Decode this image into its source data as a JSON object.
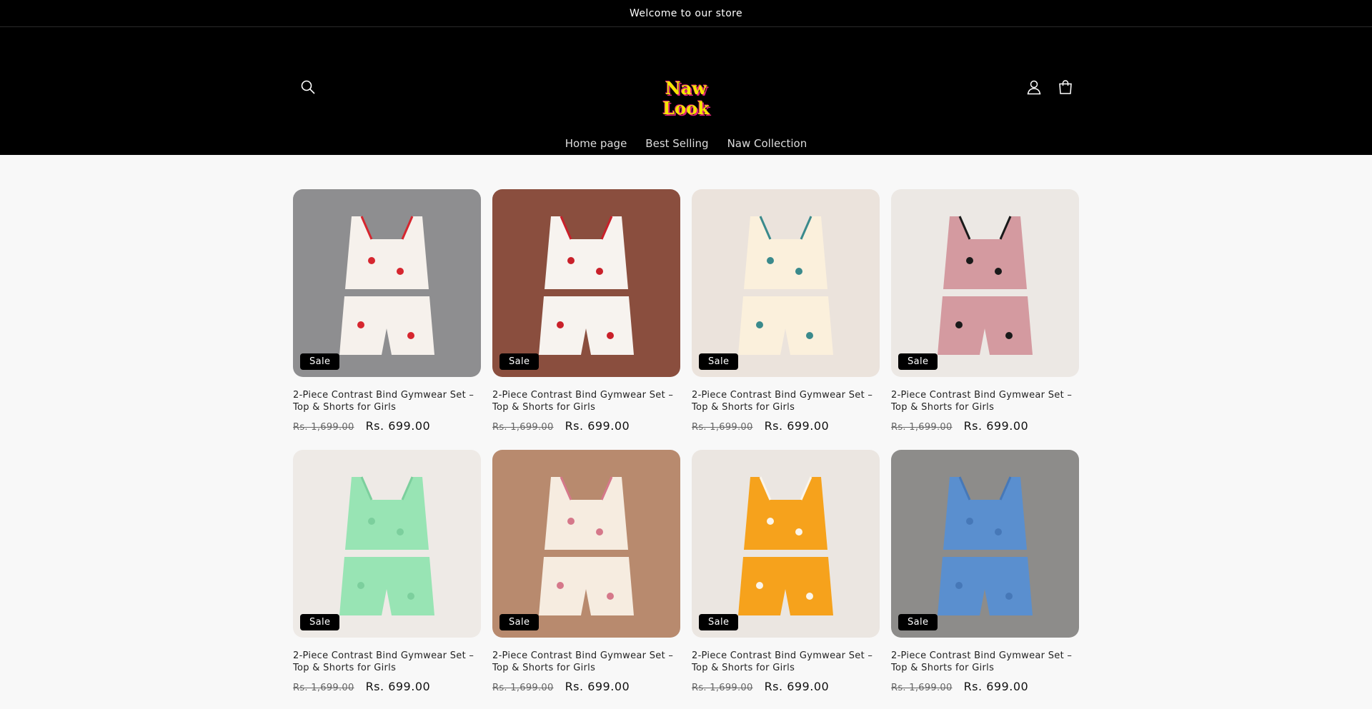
{
  "announcement": "Welcome to our store",
  "logo": {
    "line1": "Naw",
    "line2": "Look"
  },
  "nav": [
    {
      "label": "Home page"
    },
    {
      "label": "Best Selling"
    },
    {
      "label": "Naw Collection"
    }
  ],
  "icons": {
    "search": "search-icon",
    "account": "account-icon",
    "cart": "cart-icon"
  },
  "colors": {
    "header_bg": "#000000",
    "page_bg": "#f8f8f8",
    "logo_yellow": "#f3e600",
    "logo_pink": "#e0247a"
  },
  "products": [
    {
      "title": "2-Piece Contrast Bind Gymwear Set – Top & Shorts for Girls",
      "badge": "Sale",
      "compare_price": "Rs. 1,699.00",
      "price": "Rs. 699.00",
      "bg": "#8e8e90",
      "garment": "#f6f1ec",
      "accent": "#d6262f"
    },
    {
      "title": "2-Piece Contrast Bind Gymwear Set – Top & Shorts for Girls",
      "badge": "Sale",
      "compare_price": "Rs. 1,699.00",
      "price": "Rs. 699.00",
      "bg": "#8a4e3e",
      "garment": "#f7f3ef",
      "accent": "#c9202a"
    },
    {
      "title": "2-Piece Contrast Bind Gymwear Set – Top & Shorts for Girls",
      "badge": "Sale",
      "compare_price": "Rs. 1,699.00",
      "price": "Rs. 699.00",
      "bg": "#ebe3dc",
      "garment": "#fbf0dc",
      "accent": "#3a8a8c"
    },
    {
      "title": "2-Piece Contrast Bind Gymwear Set – Top & Shorts for Girls",
      "badge": "Sale",
      "compare_price": "Rs. 1,699.00",
      "price": "Rs. 699.00",
      "bg": "#ece8e4",
      "garment": "#d49aa0",
      "accent": "#1a1a1a"
    },
    {
      "title": "2-Piece Contrast Bind Gymwear Set – Top & Shorts for Girls",
      "badge": "Sale",
      "compare_price": "Rs. 1,699.00",
      "price": "Rs. 699.00",
      "bg": "#eeeae6",
      "garment": "#98e4b4",
      "accent": "#7ccf9d"
    },
    {
      "title": "2-Piece Contrast Bind Gymwear Set – Top & Shorts for Girls",
      "badge": "Sale",
      "compare_price": "Rs. 1,699.00",
      "price": "Rs. 699.00",
      "bg": "#b88a6e",
      "garment": "#f6ece0",
      "accent": "#d5788a"
    },
    {
      "title": "2-Piece Contrast Bind Gymwear Set – Top & Shorts for Girls",
      "badge": "Sale",
      "compare_price": "Rs. 1,699.00",
      "price": "Rs. 699.00",
      "bg": "#ebe6e1",
      "garment": "#f6a21c",
      "accent": "#fbf5ea"
    },
    {
      "title": "2-Piece Contrast Bind Gymwear Set – Top & Shorts for Girls",
      "badge": "Sale",
      "compare_price": "Rs. 1,699.00",
      "price": "Rs. 699.00",
      "bg": "#8d8c8a",
      "garment": "#5a8fcf",
      "accent": "#4678b8"
    }
  ]
}
